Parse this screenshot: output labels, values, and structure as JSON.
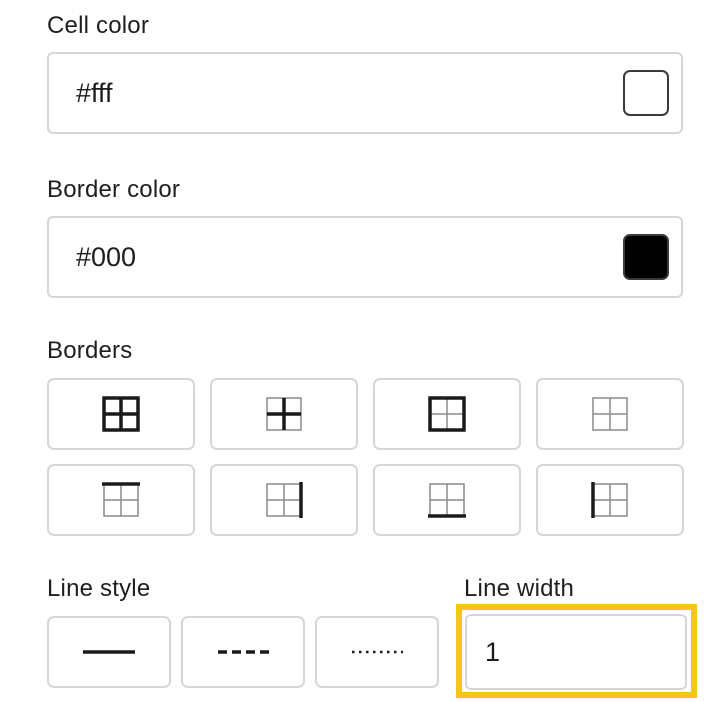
{
  "cell_color": {
    "label": "Cell color",
    "value": "#fff",
    "swatch_color": "#ffffff"
  },
  "border_color": {
    "label": "Border color",
    "value": "#000",
    "swatch_color": "#000000"
  },
  "borders": {
    "label": "Borders",
    "options": [
      {
        "name": "all-borders"
      },
      {
        "name": "inner-borders"
      },
      {
        "name": "outer-borders"
      },
      {
        "name": "no-borders"
      },
      {
        "name": "top-border"
      },
      {
        "name": "right-border"
      },
      {
        "name": "bottom-border"
      },
      {
        "name": "left-border"
      }
    ]
  },
  "line_style": {
    "label": "Line style",
    "options": [
      "solid",
      "dashed",
      "dotted"
    ]
  },
  "line_width": {
    "label": "Line width",
    "value": "1"
  },
  "colors": {
    "highlight": "#f5c518",
    "border": "#d6d6d6"
  }
}
